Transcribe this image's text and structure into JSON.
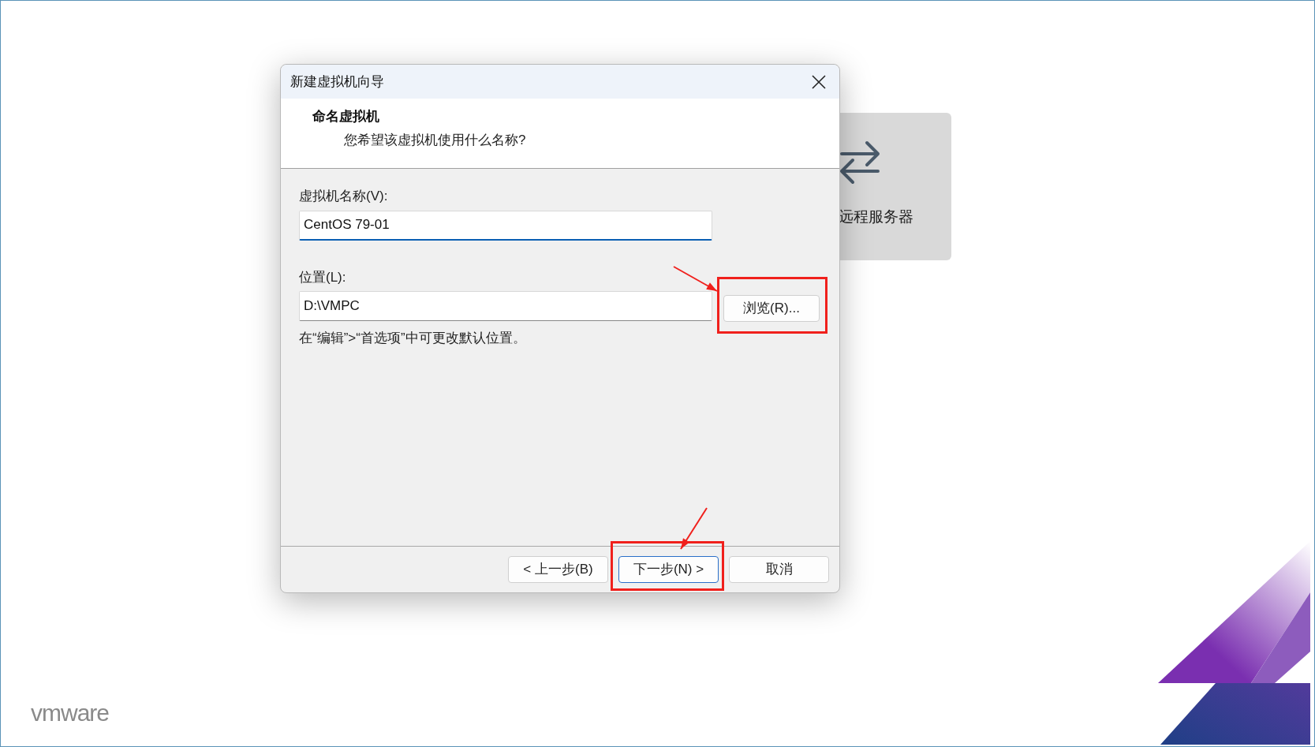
{
  "background": {
    "card_label": "远程服务器",
    "logo": "vmware"
  },
  "dialog": {
    "title": "新建虚拟机向导",
    "heading": "命名虚拟机",
    "subheading": "您希望该虚拟机使用什么名称?",
    "fields": [
      {
        "label": "虚拟机名称(V):",
        "value": "CentOS 79-01",
        "focused": true
      },
      {
        "label": "位置(L):",
        "value": "D:\\VMPC",
        "focused": false,
        "button": "浏览(R)...",
        "highlighted": true
      }
    ],
    "hint": "在“编辑”>“首选项”中可更改默认位置。",
    "buttons": [
      {
        "label": "< 上一步(B)",
        "default": false,
        "highlighted": false
      },
      {
        "label": "下一步(N) >",
        "default": true,
        "highlighted": true
      },
      {
        "label": "取消",
        "default": false,
        "highlighted": false
      }
    ]
  }
}
